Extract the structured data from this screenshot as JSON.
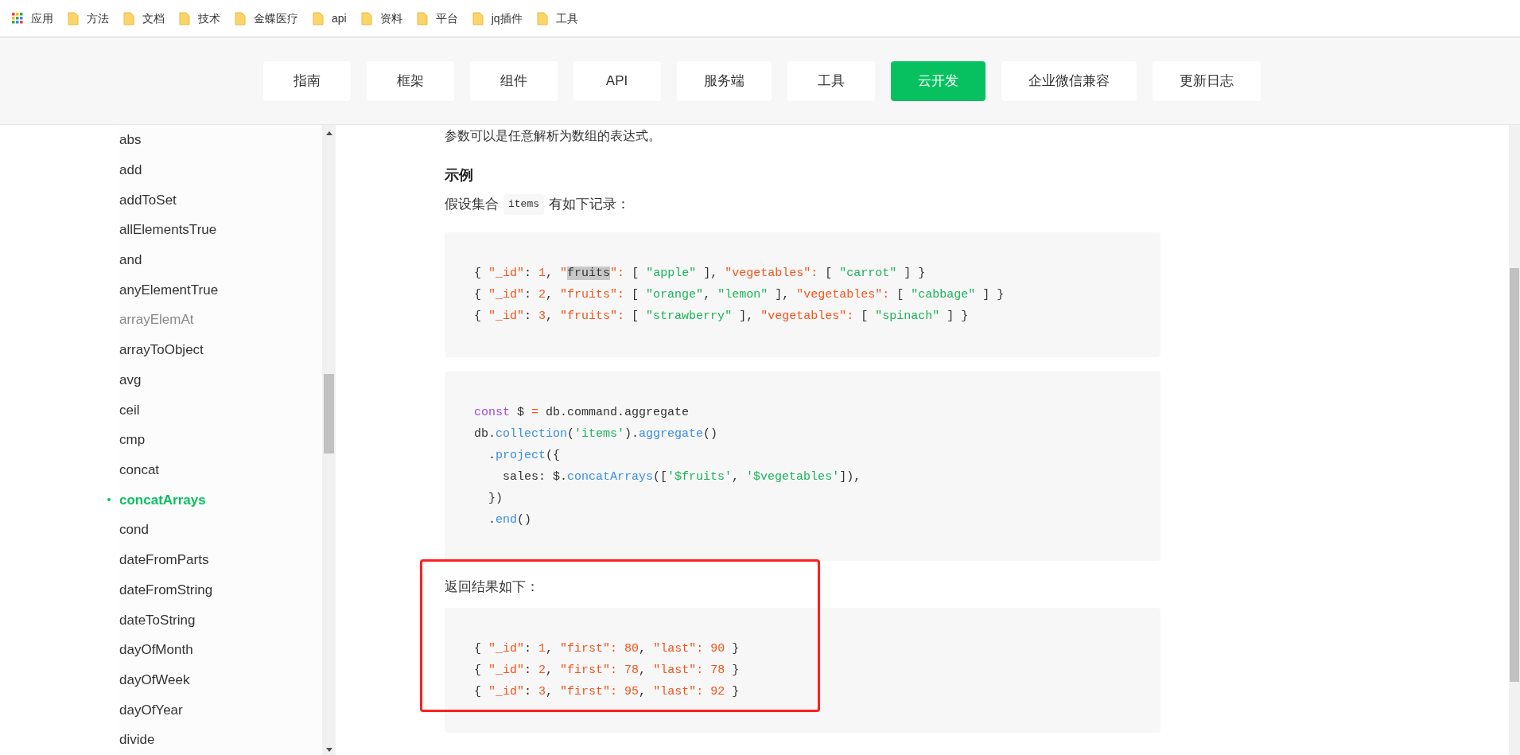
{
  "bookmarks": [
    {
      "kind": "apps",
      "label": "应用"
    },
    {
      "kind": "folder",
      "label": "方法"
    },
    {
      "kind": "folder",
      "label": "文档"
    },
    {
      "kind": "folder",
      "label": "技术"
    },
    {
      "kind": "folder",
      "label": "金蝶医疗"
    },
    {
      "kind": "folder",
      "label": "api"
    },
    {
      "kind": "folder",
      "label": "资料"
    },
    {
      "kind": "folder",
      "label": "平台"
    },
    {
      "kind": "folder",
      "label": "jq插件"
    },
    {
      "kind": "folder",
      "label": "工具"
    }
  ],
  "nav_tabs": [
    {
      "label": "指南",
      "selected": false
    },
    {
      "label": "框架",
      "selected": false
    },
    {
      "label": "组件",
      "selected": false
    },
    {
      "label": "API",
      "selected": false
    },
    {
      "label": "服务端",
      "selected": false
    },
    {
      "label": "工具",
      "selected": false
    },
    {
      "label": "云开发",
      "selected": true
    },
    {
      "label": "企业微信兼容",
      "selected": false
    },
    {
      "label": "更新日志",
      "selected": false
    }
  ],
  "sidebar": {
    "items": [
      {
        "label": "abs",
        "selected": false,
        "visited": false
      },
      {
        "label": "add",
        "selected": false,
        "visited": false
      },
      {
        "label": "addToSet",
        "selected": false,
        "visited": false
      },
      {
        "label": "allElementsTrue",
        "selected": false,
        "visited": false
      },
      {
        "label": "and",
        "selected": false,
        "visited": false
      },
      {
        "label": "anyElementTrue",
        "selected": false,
        "visited": false
      },
      {
        "label": "arrayElemAt",
        "selected": false,
        "visited": true
      },
      {
        "label": "arrayToObject",
        "selected": false,
        "visited": false
      },
      {
        "label": "avg",
        "selected": false,
        "visited": false
      },
      {
        "label": "ceil",
        "selected": false,
        "visited": false
      },
      {
        "label": "cmp",
        "selected": false,
        "visited": false
      },
      {
        "label": "concat",
        "selected": false,
        "visited": false
      },
      {
        "label": "concatArrays",
        "selected": true,
        "visited": false
      },
      {
        "label": "cond",
        "selected": false,
        "visited": false
      },
      {
        "label": "dateFromParts",
        "selected": false,
        "visited": false
      },
      {
        "label": "dateFromString",
        "selected": false,
        "visited": false
      },
      {
        "label": "dateToString",
        "selected": false,
        "visited": false
      },
      {
        "label": "dayOfMonth",
        "selected": false,
        "visited": false
      },
      {
        "label": "dayOfWeek",
        "selected": false,
        "visited": false
      },
      {
        "label": "dayOfYear",
        "selected": false,
        "visited": false
      },
      {
        "label": "divide",
        "selected": false,
        "visited": false
      }
    ]
  },
  "content": {
    "intro": "参数可以是任意解析为数组的表达式。",
    "heading": "示例",
    "sentence_before": "假设集合",
    "inline_code": "items",
    "sentence_after": "有如下记录：",
    "code_blocks": [
      {
        "lines": [
          [
            {
              "kind": "plain",
              "text": "{ "
            },
            {
              "kind": "key",
              "text": "\"_id\""
            },
            {
              "kind": "plain",
              "text": ": "
            },
            {
              "kind": "num",
              "text": "1"
            },
            {
              "kind": "plain",
              "text": ", "
            },
            {
              "kind": "key",
              "text": "\""
            },
            {
              "kind": "highlight",
              "text": "fruits"
            },
            {
              "kind": "key",
              "text": "\":"
            },
            {
              "kind": "plain",
              "text": " [ "
            },
            {
              "kind": "str",
              "text": "\"apple\""
            },
            {
              "kind": "plain",
              "text": " ], "
            },
            {
              "kind": "key",
              "text": "\"vegetables\":"
            },
            {
              "kind": "plain",
              "text": " [ "
            },
            {
              "kind": "str",
              "text": "\"carrot\""
            },
            {
              "kind": "plain",
              "text": " ] }"
            }
          ],
          [
            {
              "kind": "plain",
              "text": "{ "
            },
            {
              "kind": "key",
              "text": "\"_id\""
            },
            {
              "kind": "plain",
              "text": ": "
            },
            {
              "kind": "num",
              "text": "2"
            },
            {
              "kind": "plain",
              "text": ", "
            },
            {
              "kind": "key",
              "text": "\"fruits\":"
            },
            {
              "kind": "plain",
              "text": " [ "
            },
            {
              "kind": "str",
              "text": "\"orange\""
            },
            {
              "kind": "plain",
              "text": ", "
            },
            {
              "kind": "str",
              "text": "\"lemon\""
            },
            {
              "kind": "plain",
              "text": " ], "
            },
            {
              "kind": "key",
              "text": "\"vegetables\":"
            },
            {
              "kind": "plain",
              "text": " [ "
            },
            {
              "kind": "str",
              "text": "\"cabbage\""
            },
            {
              "kind": "plain",
              "text": " ] }"
            }
          ],
          [
            {
              "kind": "plain",
              "text": "{ "
            },
            {
              "kind": "key",
              "text": "\"_id\""
            },
            {
              "kind": "plain",
              "text": ": "
            },
            {
              "kind": "num",
              "text": "3"
            },
            {
              "kind": "plain",
              "text": ", "
            },
            {
              "kind": "key",
              "text": "\"fruits\":"
            },
            {
              "kind": "plain",
              "text": " [ "
            },
            {
              "kind": "str",
              "text": "\"strawberry\""
            },
            {
              "kind": "plain",
              "text": " ], "
            },
            {
              "kind": "key",
              "text": "\"vegetables\":"
            },
            {
              "kind": "plain",
              "text": " [ "
            },
            {
              "kind": "str",
              "text": "\"spinach\""
            },
            {
              "kind": "plain",
              "text": " ] }"
            }
          ]
        ]
      },
      {
        "lines": [
          [
            {
              "kind": "keyword",
              "text": "const"
            },
            {
              "kind": "plain",
              "text": " $ "
            },
            {
              "kind": "key",
              "text": "="
            },
            {
              "kind": "plain",
              "text": " db.command.aggregate"
            }
          ],
          [
            {
              "kind": "plain",
              "text": "db."
            },
            {
              "kind": "fn",
              "text": "collection"
            },
            {
              "kind": "plain",
              "text": "("
            },
            {
              "kind": "str",
              "text": "'items'"
            },
            {
              "kind": "plain",
              "text": ")."
            },
            {
              "kind": "fn",
              "text": "aggregate"
            },
            {
              "kind": "plain",
              "text": "()"
            }
          ],
          [
            {
              "kind": "plain",
              "text": "  ."
            },
            {
              "kind": "fn",
              "text": "project"
            },
            {
              "kind": "plain",
              "text": "({"
            }
          ],
          [
            {
              "kind": "plain",
              "text": "    sales: $."
            },
            {
              "kind": "fn",
              "text": "concatArrays"
            },
            {
              "kind": "plain",
              "text": "(["
            },
            {
              "kind": "str",
              "text": "'$fruits'"
            },
            {
              "kind": "plain",
              "text": ", "
            },
            {
              "kind": "str",
              "text": "'$vegetables'"
            },
            {
              "kind": "plain",
              "text": "]),"
            }
          ],
          [
            {
              "kind": "plain",
              "text": "  })"
            }
          ],
          [
            {
              "kind": "plain",
              "text": "  ."
            },
            {
              "kind": "fn",
              "text": "end"
            },
            {
              "kind": "plain",
              "text": "()"
            }
          ]
        ]
      }
    ],
    "result_label": "返回结果如下：",
    "result_block": {
      "lines": [
        [
          {
            "kind": "plain",
            "text": "{ "
          },
          {
            "kind": "key",
            "text": "\"_id\""
          },
          {
            "kind": "plain",
            "text": ": "
          },
          {
            "kind": "num",
            "text": "1"
          },
          {
            "kind": "plain",
            "text": ", "
          },
          {
            "kind": "key",
            "text": "\"first\": 80"
          },
          {
            "kind": "plain",
            "text": ", "
          },
          {
            "kind": "key",
            "text": "\"last\": 90"
          },
          {
            "kind": "plain",
            "text": " }"
          }
        ],
        [
          {
            "kind": "plain",
            "text": "{ "
          },
          {
            "kind": "key",
            "text": "\"_id\""
          },
          {
            "kind": "plain",
            "text": ": "
          },
          {
            "kind": "num",
            "text": "2"
          },
          {
            "kind": "plain",
            "text": ", "
          },
          {
            "kind": "key",
            "text": "\"first\": 78"
          },
          {
            "kind": "plain",
            "text": ", "
          },
          {
            "kind": "key",
            "text": "\"last\": 78"
          },
          {
            "kind": "plain",
            "text": " }"
          }
        ],
        [
          {
            "kind": "plain",
            "text": "{ "
          },
          {
            "kind": "key",
            "text": "\"_id\""
          },
          {
            "kind": "plain",
            "text": ": "
          },
          {
            "kind": "num",
            "text": "3"
          },
          {
            "kind": "plain",
            "text": ", "
          },
          {
            "kind": "key",
            "text": "\"first\": 95"
          },
          {
            "kind": "plain",
            "text": ", "
          },
          {
            "kind": "key",
            "text": "\"last\": 92"
          },
          {
            "kind": "plain",
            "text": " }"
          }
        ]
      ]
    }
  }
}
